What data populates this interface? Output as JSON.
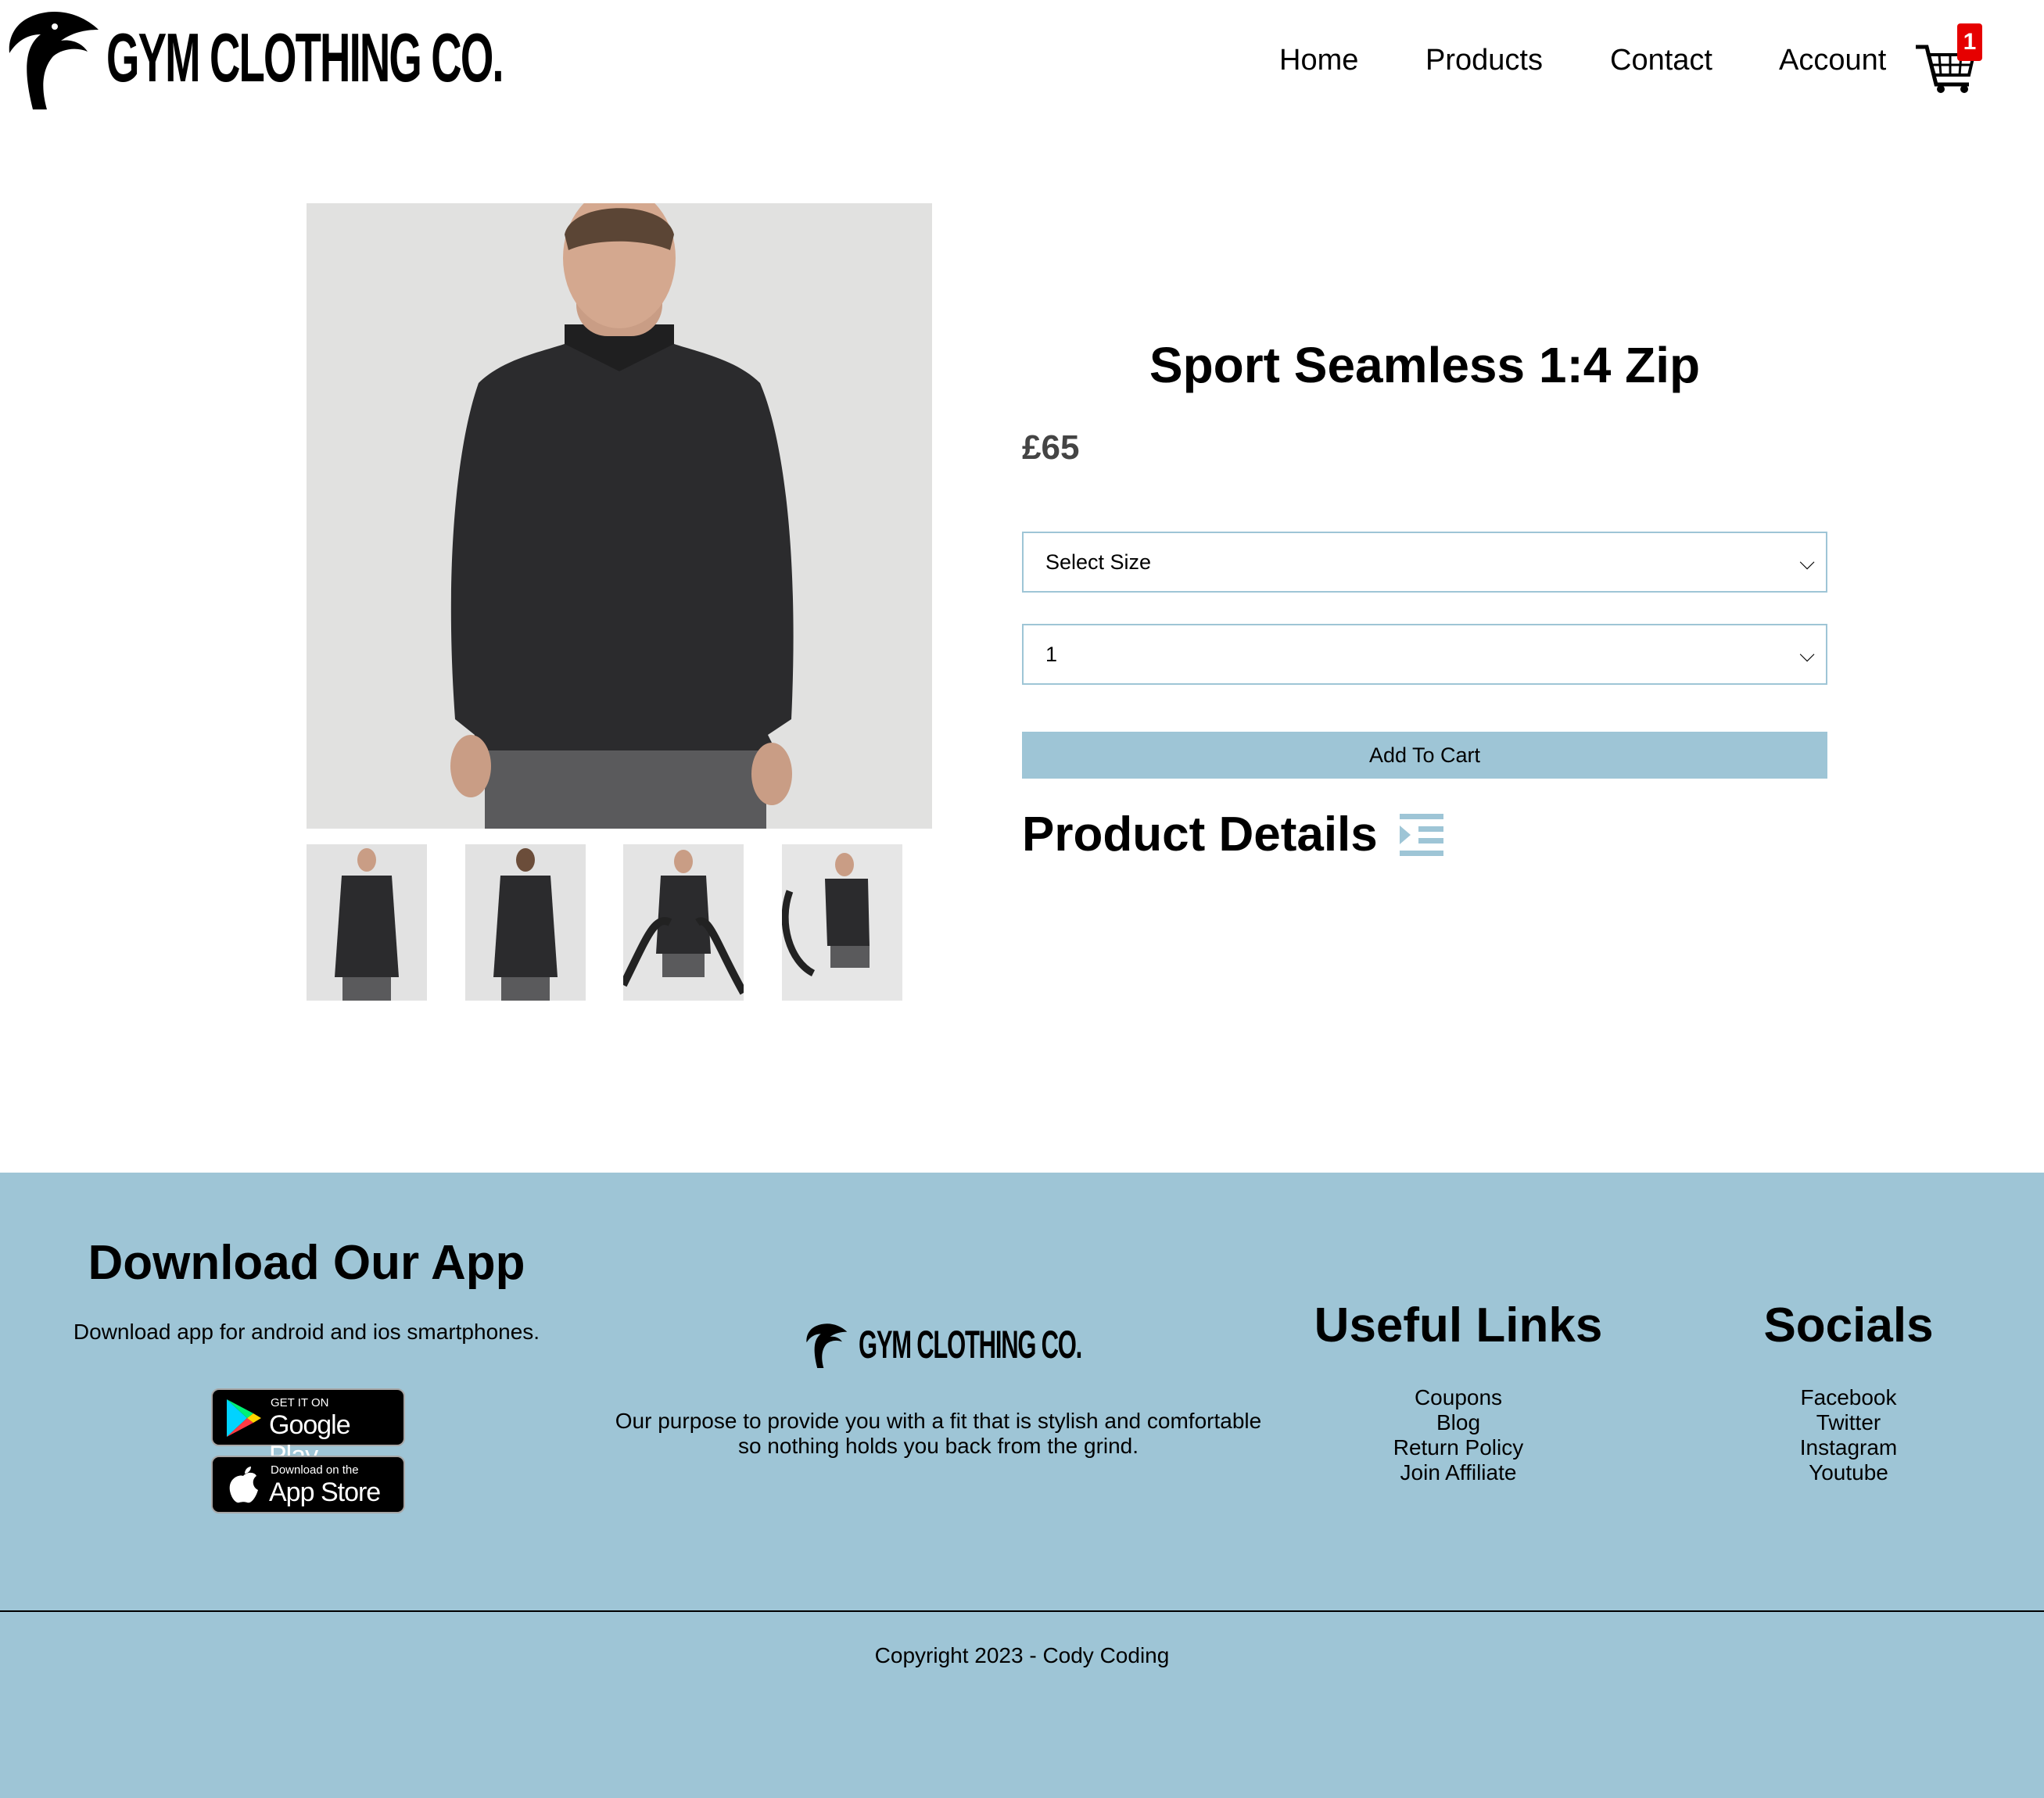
{
  "brand": {
    "name": "GYM CLOTHING CO."
  },
  "nav": {
    "home": "Home",
    "products": "Products",
    "contact": "Contact",
    "account": "Account",
    "cart_count": "1"
  },
  "product": {
    "title": "Sport Seamless 1:4 Zip",
    "price": "£65",
    "size_select": "Select Size",
    "quantity_select": "1",
    "add_to_cart": "Add To Cart",
    "details_heading": "Product Details"
  },
  "footer": {
    "app_title": "Download Our App",
    "app_subtitle": "Download app for android and ios smartphones.",
    "google_small": "GET IT ON",
    "google_big": "Google Play",
    "apple_small": "Download on the",
    "apple_big": "App Store",
    "purpose_line1": "Our purpose to provide you with a fit that is stylish and comfortable",
    "purpose_line2": "so nothing holds you back from the grind.",
    "useful_title": "Useful Links",
    "useful_links": [
      "Coupons",
      "Blog",
      "Return Policy",
      "Join Affiliate"
    ],
    "socials_title": "Socials",
    "socials_links": [
      "Facebook",
      "Twitter",
      "Instagram",
      "Youtube"
    ],
    "copyright": "Copyright 2023 - Cody Coding"
  },
  "colors": {
    "accent": "#9ec5d6",
    "badge": "#e60000"
  }
}
